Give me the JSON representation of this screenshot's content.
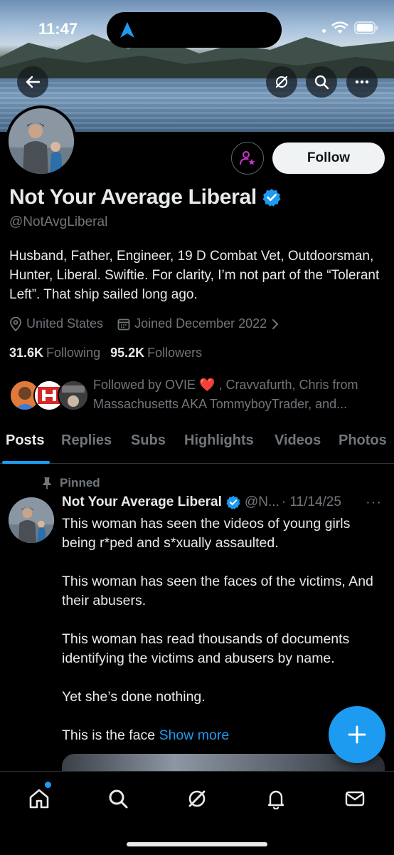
{
  "status_bar": {
    "time": "11:47"
  },
  "profile": {
    "display_name": "Not Your Average Liberal",
    "handle": "@NotAvgLiberal",
    "bio": "Husband, Father, Engineer, 19 D Combat Vet, Outdoorsman, Hunter, Liberal. Swiftie. For clarity, I’m not part of the “Tolerant Left”. That ship sailed long ago.",
    "location": "United States",
    "joined": "Joined December 2022",
    "following_count": "31.6K",
    "following_label": "Following",
    "followers_count": "95.2K",
    "followers_label": "Followers",
    "followed_by_text": "Followed by OVIE ❤️ , Cravvafurth, Chris from Massachusetts AKA TommyboyTrader, and..."
  },
  "buttons": {
    "follow_label": "Follow"
  },
  "tabs": [
    "Posts",
    "Replies",
    "Subs",
    "Highlights",
    "Videos",
    "Photos"
  ],
  "tweet": {
    "pinned_label": "Pinned",
    "author_name": "Not Your Average Liberal",
    "author_handle": "@N...",
    "date": "· 11/14/25",
    "more": "···",
    "paragraphs": [
      "This woman has seen the videos of young girls being r*ped and s*xually assaulted.",
      "This woman has seen the faces of the victims, And their abusers.",
      "This woman has read thousands of documents identifying the victims and abusers by name.",
      "Yet she’s done nothing."
    ],
    "last_line": "This is the face",
    "show_more": "Show more"
  },
  "nav_icons": [
    "home-icon",
    "search-icon",
    "grok-icon",
    "notifications-icon",
    "messages-icon"
  ],
  "colors": {
    "accent": "#1d9bf0",
    "background": "#000000",
    "secondary_text": "#71767b",
    "subscribe_accent": "#c936c9"
  }
}
